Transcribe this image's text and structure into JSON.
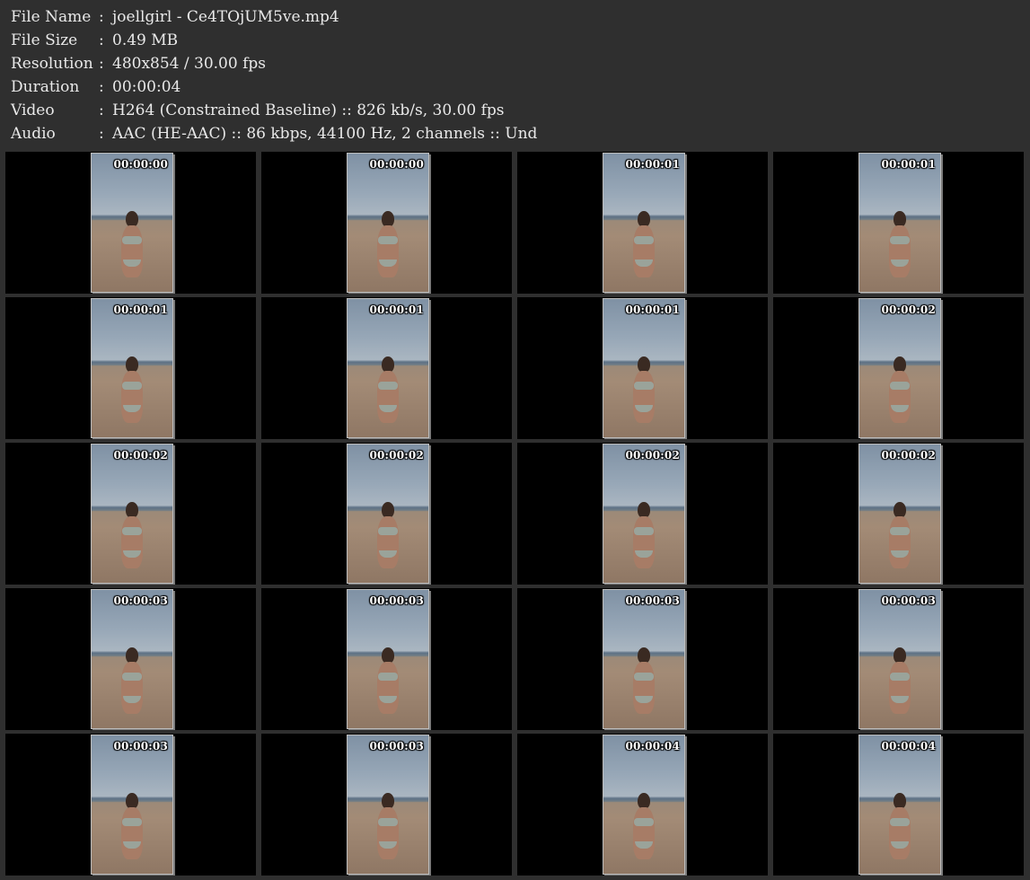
{
  "info": [
    {
      "label": "File Name",
      "sep": ":",
      "value": "joellgirl - Ce4TOjUM5ve.mp4"
    },
    {
      "label": "File Size",
      "sep": ":",
      "value": "0.49 MB"
    },
    {
      "label": "Resolution",
      "sep": ":",
      "value": "480x854 / 30.00 fps"
    },
    {
      "label": "Duration",
      "sep": ":",
      "value": "00:00:04"
    },
    {
      "label": "Video",
      "sep": ":",
      "value": "H264 (Constrained Baseline) :: 826 kb/s, 30.00 fps"
    },
    {
      "label": "Audio",
      "sep": ":",
      "value": "AAC (HE-AAC) :: 86 kbps, 44100 Hz, 2 channels :: Und"
    }
  ],
  "thumbnails": [
    {
      "timestamp": "00:00:00"
    },
    {
      "timestamp": "00:00:00"
    },
    {
      "timestamp": "00:00:01"
    },
    {
      "timestamp": "00:00:01"
    },
    {
      "timestamp": "00:00:01"
    },
    {
      "timestamp": "00:00:01"
    },
    {
      "timestamp": "00:00:01"
    },
    {
      "timestamp": "00:00:02"
    },
    {
      "timestamp": "00:00:02"
    },
    {
      "timestamp": "00:00:02"
    },
    {
      "timestamp": "00:00:02"
    },
    {
      "timestamp": "00:00:02"
    },
    {
      "timestamp": "00:00:03"
    },
    {
      "timestamp": "00:00:03"
    },
    {
      "timestamp": "00:00:03"
    },
    {
      "timestamp": "00:00:03"
    },
    {
      "timestamp": "00:00:03"
    },
    {
      "timestamp": "00:00:03"
    },
    {
      "timestamp": "00:00:04"
    },
    {
      "timestamp": "00:00:04"
    }
  ]
}
